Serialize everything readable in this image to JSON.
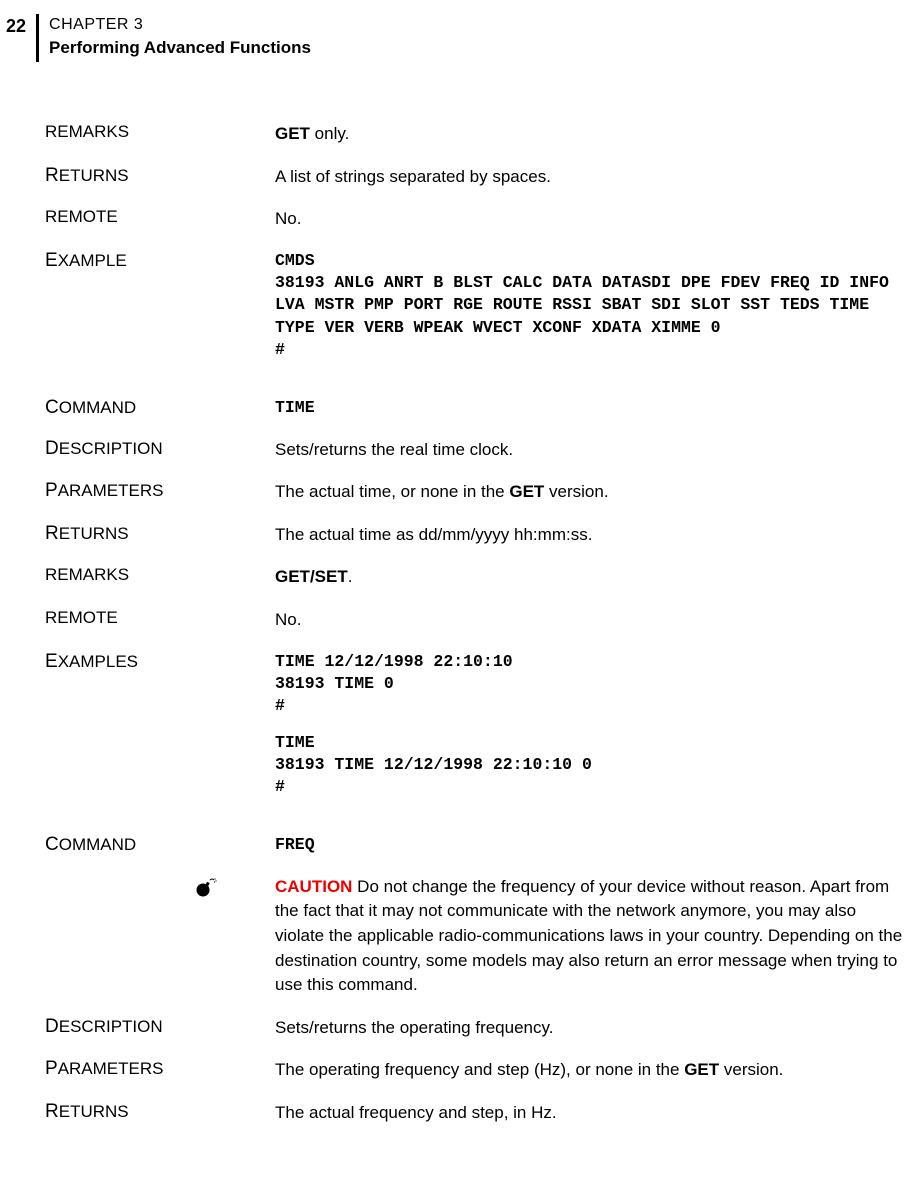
{
  "header": {
    "page_number": "22",
    "chapter_line": "CHAPTER 3",
    "chapter_subtitle": "Performing Advanced Functions"
  },
  "rows": {
    "remarks1_label": "REMARKS",
    "remarks1_bold": "GET",
    "remarks1_rest": " only.",
    "returns1_label": "ETURNS",
    "returns1_cap": "R",
    "returns1_value": "A list of strings separated by spaces.",
    "remote1_label": "REMOTE",
    "remote1_value": "No.",
    "example1_cap": "E",
    "example1_label": "XAMPLE",
    "example1_code": "CMDS\n38193 ANLG ANRT B BLST CALC DATA DATASDI DPE FDEV FREQ ID INFO LVA MSTR PMP PORT RGE ROUTE RSSI SBAT SDI SLOT SST TEDS TIME TYPE VER VERB WPEAK WVECT XCONF XDATA XIMME 0\n#",
    "command2_cap": "C",
    "command2_label": "OMMAND",
    "command2_code": "TIME",
    "description2_cap": "D",
    "description2_label": "ESCRIPTION",
    "description2_value": "Sets/returns the real time clock.",
    "parameters2_cap": "P",
    "parameters2_label": "ARAMETERS",
    "parameters2_pre": "The actual time, or none in the ",
    "parameters2_bold": "GET",
    "parameters2_post": " version.",
    "returns2_cap": "R",
    "returns2_label": "ETURNS",
    "returns2_value": "The actual time as dd/mm/yyyy hh:mm:ss.",
    "remarks2_label": "REMARKS",
    "remarks2_bold": "GET/SET",
    "remarks2_rest": ".",
    "remote2_label": "REMOTE",
    "remote2_value": "No.",
    "examples2_cap": "E",
    "examples2_label": "XAMPLES",
    "examples2_code1": "TIME 12/12/1998 22:10:10\n38193 TIME 0\n#",
    "examples2_code2": "TIME\n38193 TIME 12/12/1998 22:10:10 0\n#",
    "command3_cap": "C",
    "command3_label": "OMMAND",
    "command3_code": "FREQ",
    "caution_word": "CAUTION",
    "caution_text": " Do not change the frequency of your device without reason. Apart from the fact that it may not communicate with the network anymore, you may also violate the applicable radio-communications laws in your country. Depending on the destination country, some models may also return an error message when trying to use this command.",
    "description3_cap": "D",
    "description3_label": "ESCRIPTION",
    "description3_value": "Sets/returns the operating frequency.",
    "parameters3_cap": "P",
    "parameters3_label": "ARAMETERS",
    "parameters3_pre": "The operating frequency and step (Hz), or none in the ",
    "parameters3_bold": "GET",
    "parameters3_post": " version.",
    "returns3_cap": "R",
    "returns3_label": "ETURNS",
    "returns3_value": "The actual frequency and step, in Hz."
  }
}
